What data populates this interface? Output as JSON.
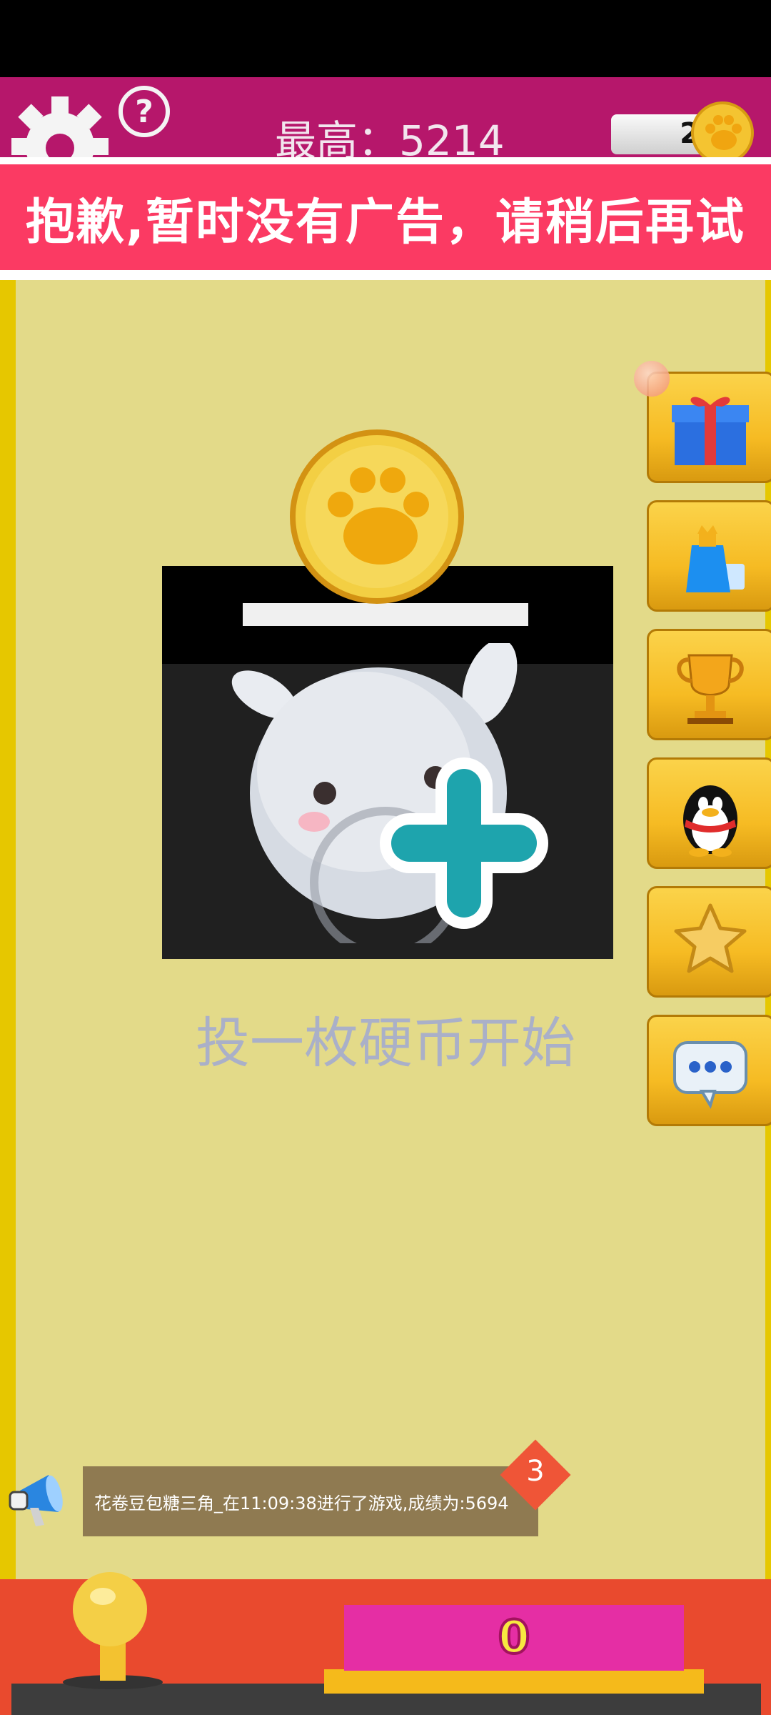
{
  "header": {
    "best_label": "最高：5214",
    "coins": "2"
  },
  "toast": {
    "message": "抱歉,暂时没有广告，请稍后再试"
  },
  "main": {
    "insert_coin_label": "投一枚硬币开始"
  },
  "side_buttons": [
    {
      "icon": "gift-icon"
    },
    {
      "icon": "potion-icon"
    },
    {
      "icon": "trophy-icon"
    },
    {
      "icon": "qq-penguin-icon"
    },
    {
      "icon": "star-icon"
    },
    {
      "icon": "chat-bubble-icon"
    }
  ],
  "ticker": {
    "message": "花卷豆包糖三角_在11:09:38进行了游戏,成绩为:5694",
    "badge": "3"
  },
  "bottom": {
    "counter": "0"
  },
  "colors": {
    "background": "#e3da89",
    "header": "#b6176b",
    "toast": "#fb3a63",
    "bottom": "#e94a2e",
    "counter": "#e52ea4"
  }
}
